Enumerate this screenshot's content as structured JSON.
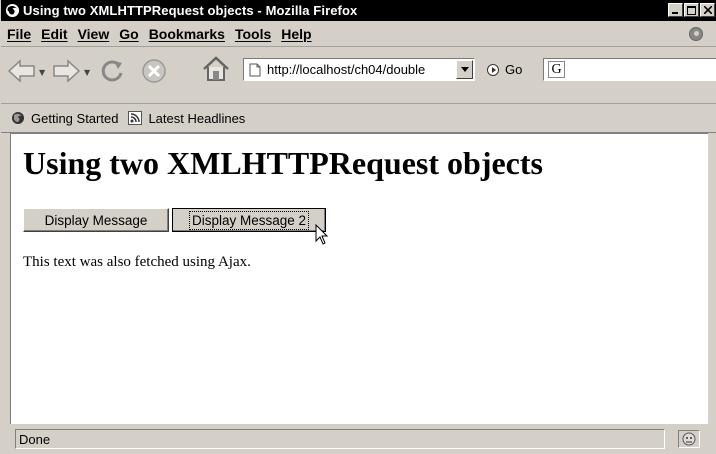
{
  "window": {
    "title": "Using two XMLHTTPRequest objects - Mozilla Firefox",
    "controls": {
      "minimize": "_",
      "maximize": "□",
      "close": "x"
    }
  },
  "menu": {
    "items": [
      {
        "label": "File"
      },
      {
        "label": "Edit"
      },
      {
        "label": "View"
      },
      {
        "label": "Go"
      },
      {
        "label": "Bookmarks"
      },
      {
        "label": "Tools"
      },
      {
        "label": "Help"
      }
    ]
  },
  "navigation": {
    "url": "http://localhost/ch04/double",
    "go_label": "Go",
    "search_engine_letter": "G"
  },
  "bookmarks": {
    "items": [
      {
        "label": "Getting Started",
        "icon": "firefox-icon"
      },
      {
        "label": "Latest Headlines",
        "icon": "rss-feed-icon"
      }
    ]
  },
  "page": {
    "heading": "Using two XMLHTTPRequest objects",
    "button1": "Display Message",
    "button2": "Display Message 2",
    "text": "This text was also fetched using Ajax."
  },
  "status": {
    "text": "Done"
  },
  "colors": {
    "chrome": "#d4d0c8",
    "titlebar": "#000000",
    "content_bg": "#ffffff"
  }
}
